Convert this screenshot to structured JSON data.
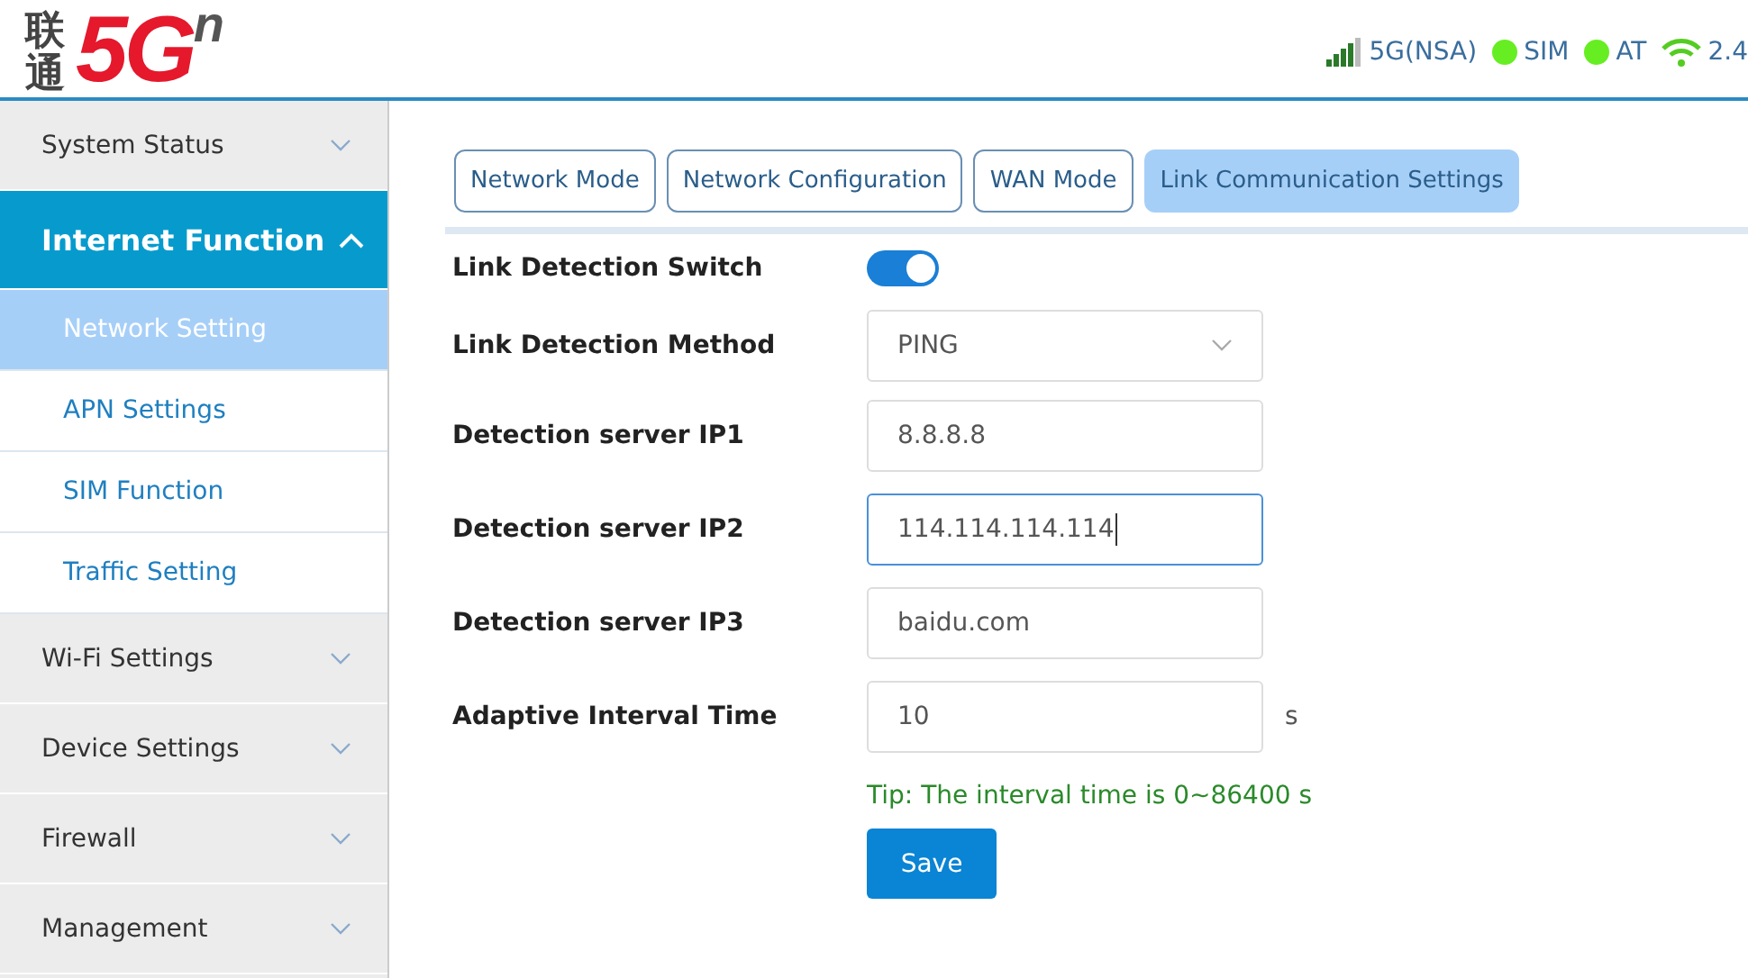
{
  "header": {
    "logo": {
      "chinese": "联通",
      "mark": "5G",
      "superscript": "n"
    },
    "status": [
      {
        "kind": "signal",
        "label": "5G(NSA)"
      },
      {
        "kind": "dot",
        "label": "SIM",
        "color": "#66ee22"
      },
      {
        "kind": "dot",
        "label": "AT",
        "color": "#66ee22"
      },
      {
        "kind": "wifi",
        "label": "2.4"
      }
    ]
  },
  "sidebar": {
    "items": [
      {
        "label": "System Status",
        "expanded": false
      },
      {
        "label": "Internet Function",
        "expanded": true,
        "children": [
          {
            "label": "Network Setting",
            "selected": true
          },
          {
            "label": "APN Settings",
            "selected": false
          },
          {
            "label": "SIM Function",
            "selected": false
          },
          {
            "label": "Traffic Setting",
            "selected": false
          }
        ]
      },
      {
        "label": "Wi-Fi Settings",
        "expanded": false
      },
      {
        "label": "Device Settings",
        "expanded": false
      },
      {
        "label": "Firewall",
        "expanded": false
      },
      {
        "label": "Management",
        "expanded": false
      }
    ]
  },
  "tabs": [
    {
      "label": "Network Mode",
      "selected": false
    },
    {
      "label": "Network Configuration",
      "selected": false
    },
    {
      "label": "WAN Mode",
      "selected": false
    },
    {
      "label": "Link Communication Settings",
      "selected": true
    }
  ],
  "form": {
    "rows": [
      {
        "kind": "toggle",
        "label": "Link Detection Switch",
        "on": true
      },
      {
        "kind": "select",
        "label": "Link Detection Method",
        "value": "PING"
      },
      {
        "kind": "input",
        "label": "Detection server IP1",
        "value": "8.8.8.8",
        "focused": false
      },
      {
        "kind": "input",
        "label": "Detection server IP2",
        "value": "114.114.114.114",
        "focused": true
      },
      {
        "kind": "input",
        "label": "Detection server IP3",
        "value": "baidu.com",
        "focused": false
      },
      {
        "kind": "input",
        "label": "Adaptive Interval Time",
        "value": "10",
        "focused": false,
        "unit": "s"
      }
    ],
    "tip": "Tip: The interval time is 0~86400 s",
    "save": "Save"
  }
}
